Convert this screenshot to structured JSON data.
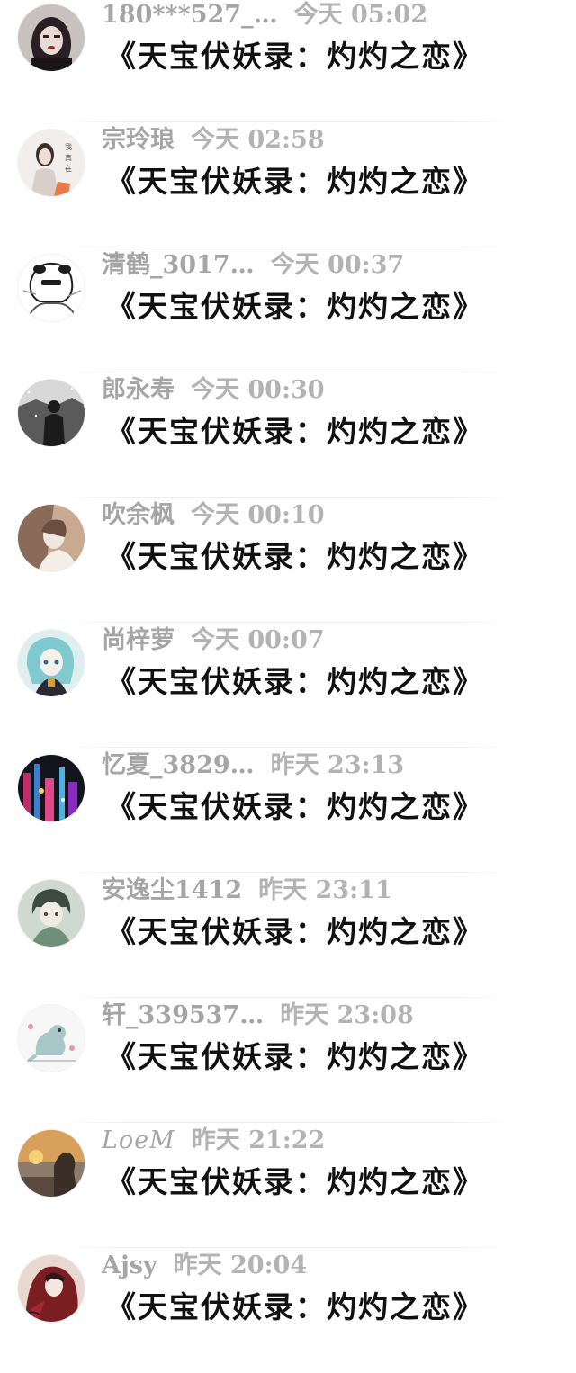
{
  "messages": [
    {
      "name": "180***527_…",
      "time": "今天 05:02",
      "text": "《天宝伏妖录：灼灼之恋》",
      "avatar_icon": "avatar-girl-red-lips-icon",
      "colors": [
        "#2a1f24",
        "#c9c1bd",
        "#8a2a2f"
      ]
    },
    {
      "name": "宗玲琅",
      "time": "今天 02:58",
      "text": "《天宝伏妖录：灼灼之恋》",
      "avatar_icon": "avatar-girl-white-dress-icon",
      "colors": [
        "#f2eeec",
        "#d9cfc9",
        "#e67a4a"
      ]
    },
    {
      "name": "清鹤_3017…",
      "time": "今天 00:37",
      "text": "《天宝伏妖录：灼灼之恋》",
      "avatar_icon": "avatar-sketch-character-icon",
      "colors": [
        "#ffffff",
        "#bdbdbd",
        "#1c1c1c"
      ]
    },
    {
      "name": "郎永寿",
      "time": "今天 00:30",
      "text": "《天宝伏妖录：灼灼之恋》",
      "avatar_icon": "avatar-snow-figure-icon",
      "colors": [
        "#5a5a5a",
        "#d8d8d8",
        "#1b1b1b"
      ]
    },
    {
      "name": "吹余枫",
      "time": "今天 00:10",
      "text": "《天宝伏妖录：灼灼之恋》",
      "avatar_icon": "avatar-portrait-warm-icon",
      "colors": [
        "#8a6a58",
        "#efe7df",
        "#c9a98f"
      ]
    },
    {
      "name": "尚梓萝",
      "time": "今天 00:07",
      "text": "《天宝伏妖录：灼灼之恋》",
      "avatar_icon": "avatar-anime-teal-hair-icon",
      "colors": [
        "#7fc9cf",
        "#f4f1ec",
        "#2a2a34"
      ]
    },
    {
      "name": "忆夏_3829…",
      "time": "昨天 23:13",
      "text": "《天宝伏妖录：灼灼之恋》",
      "avatar_icon": "avatar-neon-city-icon",
      "colors": [
        "#14141f",
        "#c22c6b",
        "#3a7fd0"
      ]
    },
    {
      "name": "安逸尘1412",
      "time": "昨天 23:11",
      "text": "《天宝伏妖录：灼灼之恋》",
      "avatar_icon": "avatar-anime-boy-green-icon",
      "colors": [
        "#cfd9cf",
        "#3c4a40",
        "#6f8f78"
      ]
    },
    {
      "name": "轩_339537…",
      "time": "昨天 23:08",
      "text": "《天宝伏妖录：灼灼之恋》",
      "avatar_icon": "avatar-cute-dinosaur-icon",
      "colors": [
        "#f7f7f7",
        "#a9c7c9",
        "#e59aa6"
      ]
    },
    {
      "name": "LoeM",
      "time": "昨天 21:22",
      "text": "《天宝伏妖录：灼灼之恋》",
      "avatar_icon": "avatar-sunset-profile-icon",
      "colors": [
        "#3a2e26",
        "#d9a05c",
        "#8c7a6a"
      ]
    },
    {
      "name": "Ajsy",
      "time": "昨天 20:04",
      "text": "《天宝伏妖录：灼灼之恋》",
      "avatar_icon": "avatar-red-costume-icon",
      "colors": [
        "#7a1e22",
        "#e9d8cf",
        "#2a1a1a"
      ]
    }
  ]
}
